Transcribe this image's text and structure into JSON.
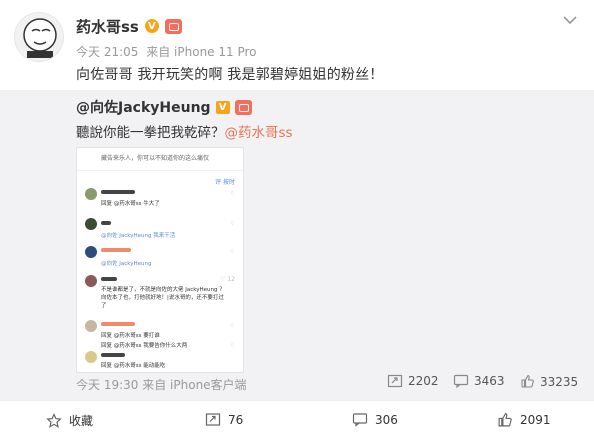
{
  "post": {
    "author": "药水哥ss",
    "verified_mark": "V",
    "level_badge": "fan-club-badge",
    "time": "今天 21:05",
    "source": "来自 iPhone 11 Pro",
    "text": "向佐哥哥 我开玩笑的啊 我是郭碧婷姐姐的粉丝！",
    "menu_icon": "chevron-down-icon"
  },
  "repost": {
    "author": "@向佐JackyHeung",
    "verified_mark": "V",
    "text_prefix": "聽說你能一拳把我乾碎？",
    "mention": "@药水哥ss",
    "time": "今天 19:30",
    "source": "来自 iPhone客户端",
    "stats": {
      "reposts": "2202",
      "comments": "3463",
      "likes": "33235"
    },
    "screenshot": {
      "top_line": "藏告来乐人，你可以不知道你的这么痛仅",
      "sort_label": "评 按时",
      "comments": [
        {
          "text": "回复 @药水哥ss 牛大了",
          "likes": "♢"
        },
        {
          "text": "@向佐 JackyHeung 我来干活",
          "likes": "♢"
        },
        {
          "text": "@向佐 JackyHeung",
          "likes": "♢"
        },
        {
          "text": "不是谁都是了，不就是向佐的大佬 JackyHeung ？",
          "text2": "向佐本了也，打他就好地！|说水哥的，还不要打过",
          "text3": "了",
          "likes": "♡ 12"
        },
        {
          "text": "回复 @药水哥ss 要打谁",
          "likes": "♢"
        },
        {
          "text": "回复 @药水哥ss 我要告你什么大两",
          "likes": "♢"
        },
        {
          "text": "回复 @药水哥ss 能动能吃",
          "likes": ""
        }
      ]
    }
  },
  "actions": {
    "favorite": "收藏",
    "repost": "76",
    "comment": "306",
    "like": "2091"
  },
  "colors": {
    "accent": "#eb7350",
    "verified": "#f7a41b",
    "repost_bg": "#f2f2f5",
    "link_blue": "#5b8ad3"
  }
}
